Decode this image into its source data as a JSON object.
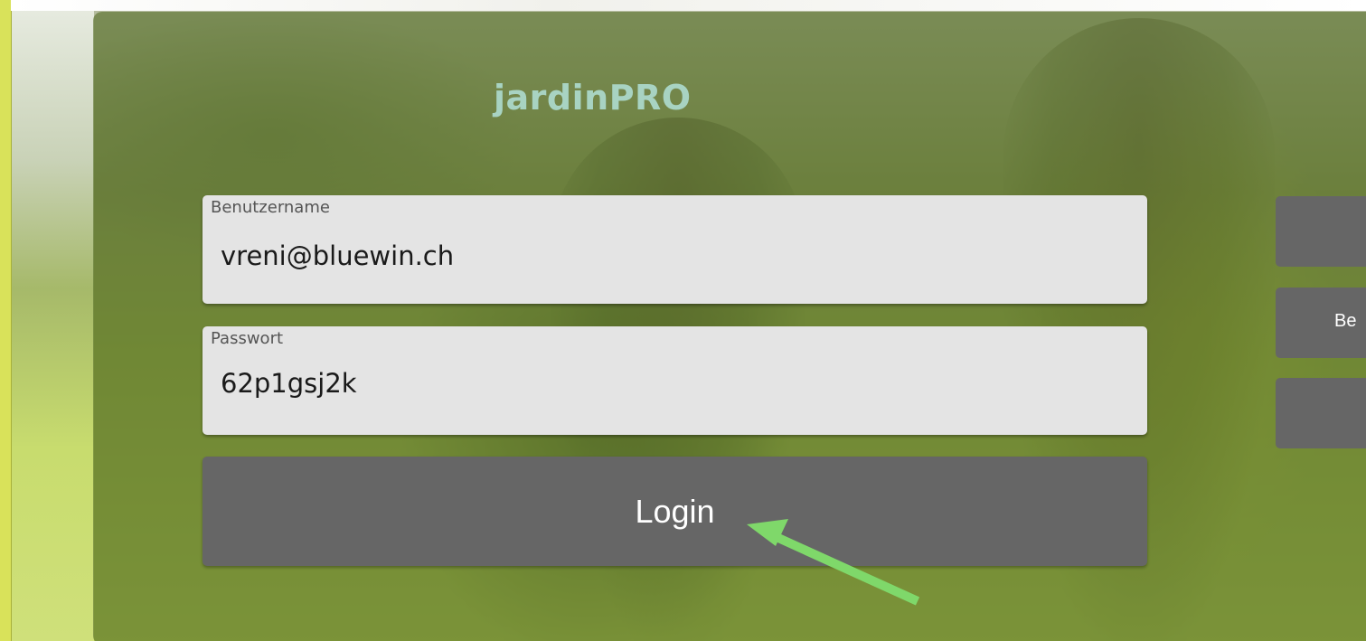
{
  "app": {
    "brand_title": "jardinPRO"
  },
  "login_form": {
    "username": {
      "label": "Benutzername",
      "value": "vreni@bluewin.ch"
    },
    "password": {
      "label": "Passwort",
      "value": "62p1gsj2k"
    },
    "login_button_label": "Login"
  },
  "side_buttons": [
    {
      "label": ""
    },
    {
      "label": "Be"
    },
    {
      "label": ""
    }
  ],
  "annotation": {
    "arrow_color": "#7fd86a"
  },
  "colors": {
    "overlay": "#566e28",
    "brand_title": "#a8d3c2",
    "field_bg": "#e4e4e4",
    "button_bg": "#666666",
    "button_text": "#ffffff"
  }
}
